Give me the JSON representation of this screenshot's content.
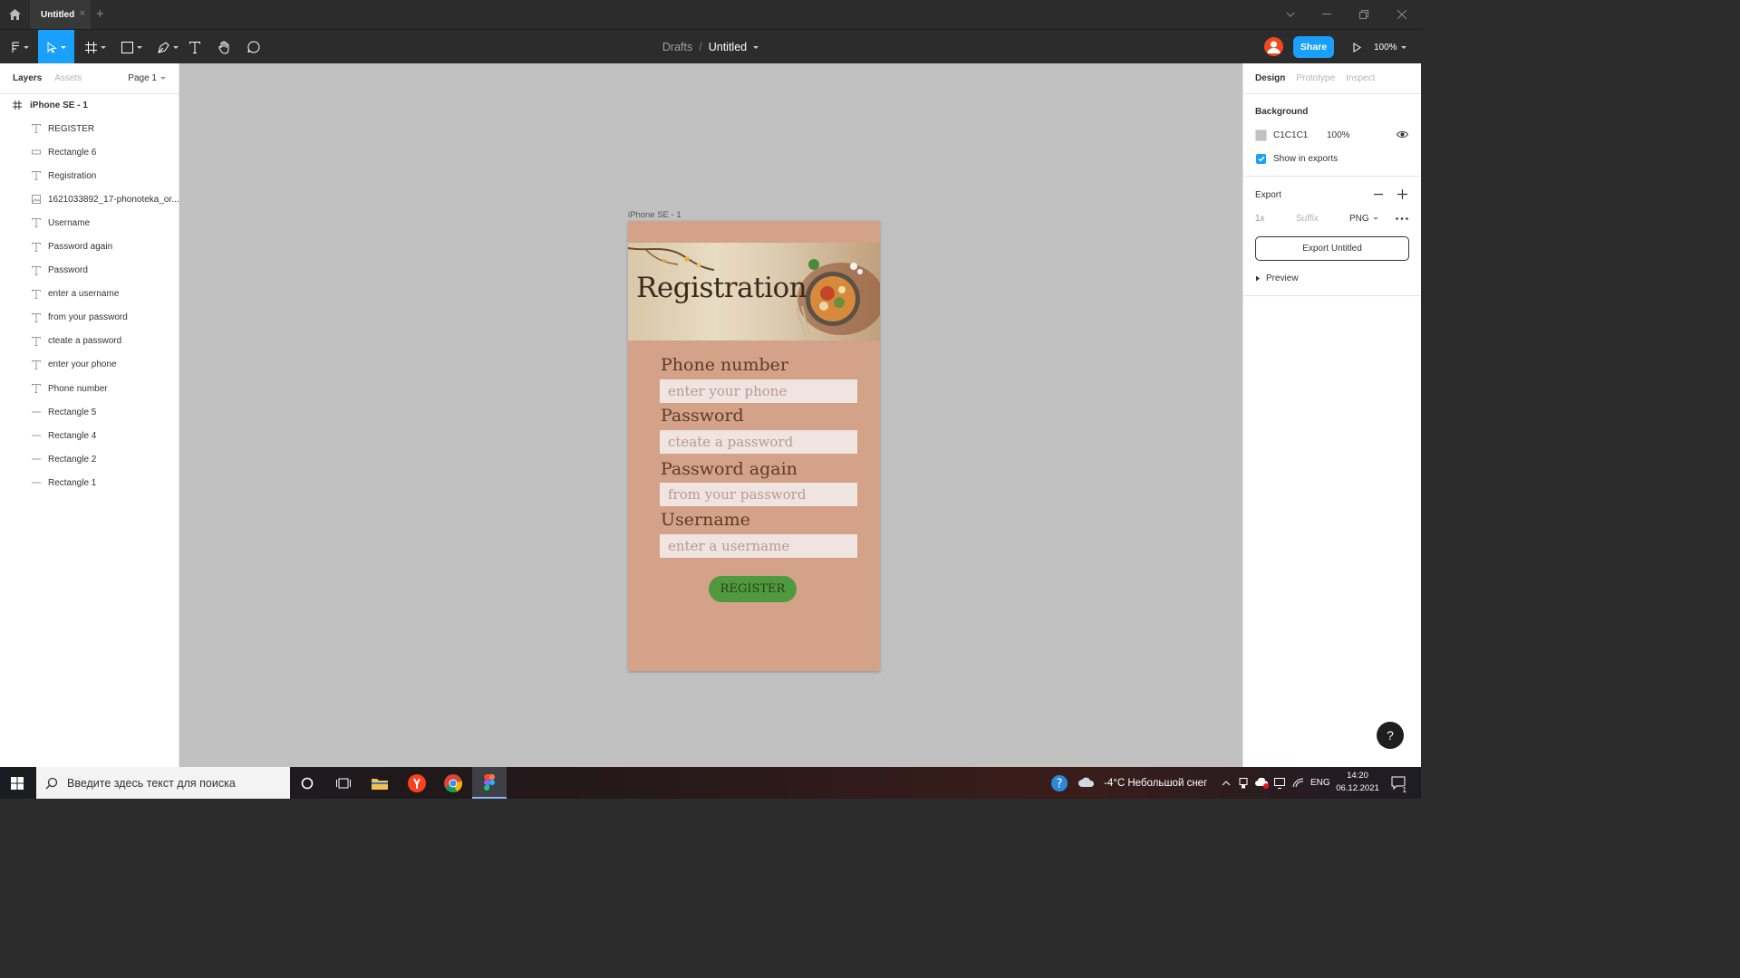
{
  "window": {
    "tab_title": "Untitled",
    "tab_close": "×",
    "new_tab": "+"
  },
  "toolbar": {
    "breadcrumb_drafts": "Drafts",
    "breadcrumb_sep": "/",
    "file_name": "Untitled",
    "share_label": "Share",
    "zoom": "100%"
  },
  "left_panel": {
    "tabs": [
      "Layers",
      "Assets"
    ],
    "page": "Page 1",
    "frame": "iPhone SE - 1",
    "layers": [
      {
        "name": "REGISTER",
        "icon": "text-icon"
      },
      {
        "name": "Rectangle 6",
        "icon": "rectangle-icon"
      },
      {
        "name": "Registration",
        "icon": "text-icon"
      },
      {
        "name": "1621033892_17-phonoteka_or...",
        "icon": "image-icon"
      },
      {
        "name": "Username",
        "icon": "text-icon"
      },
      {
        "name": "Password again",
        "icon": "text-icon"
      },
      {
        "name": "Password",
        "icon": "text-icon"
      },
      {
        "name": "enter a username",
        "icon": "text-icon"
      },
      {
        "name": "from your password",
        "icon": "text-icon"
      },
      {
        "name": "cteate a password",
        "icon": "text-icon"
      },
      {
        "name": "enter your phone",
        "icon": "text-icon"
      },
      {
        "name": "Phone number",
        "icon": "text-icon"
      },
      {
        "name": "Rectangle 5",
        "icon": "line-icon"
      },
      {
        "name": "Rectangle 4",
        "icon": "line-icon"
      },
      {
        "name": "Rectangle 2",
        "icon": "line-icon"
      },
      {
        "name": "Rectangle 1",
        "icon": "line-icon"
      }
    ]
  },
  "canvas": {
    "frame_label": "iPhone SE - 1",
    "background": "#c1c1c1",
    "design": {
      "title": "Registration",
      "bg_color": "#d4a189",
      "fields": [
        {
          "label": "Phone number",
          "placeholder": "enter your phone"
        },
        {
          "label": "Password",
          "placeholder": "cteate a password"
        },
        {
          "label": "Password again",
          "placeholder": "from your password"
        },
        {
          "label": "Username",
          "placeholder": "enter a username"
        }
      ],
      "button": "REGISTER",
      "button_color": "#4f9a3e"
    }
  },
  "right_panel": {
    "tabs": [
      "Design",
      "Prototype",
      "Inspect"
    ],
    "background_title": "Background",
    "bg_hex": "C1C1C1",
    "bg_opacity": "100%",
    "show_in_exports": "Show in exports",
    "export_title": "Export",
    "export_scale": "1x",
    "export_suffix_placeholder": "Suffix",
    "export_format": "PNG",
    "export_button": "Export Untitled",
    "preview": "Preview",
    "help": "?"
  },
  "taskbar": {
    "search_placeholder": "Введите здесь текст для поиска",
    "weather": "-4°C  Небольшой снег",
    "lang": "ENG",
    "time": "14:20",
    "date": "06.12.2021",
    "notifications": "1"
  },
  "colors": {
    "accent": "#18a0fb",
    "figma_dark": "#2c2c2c"
  }
}
